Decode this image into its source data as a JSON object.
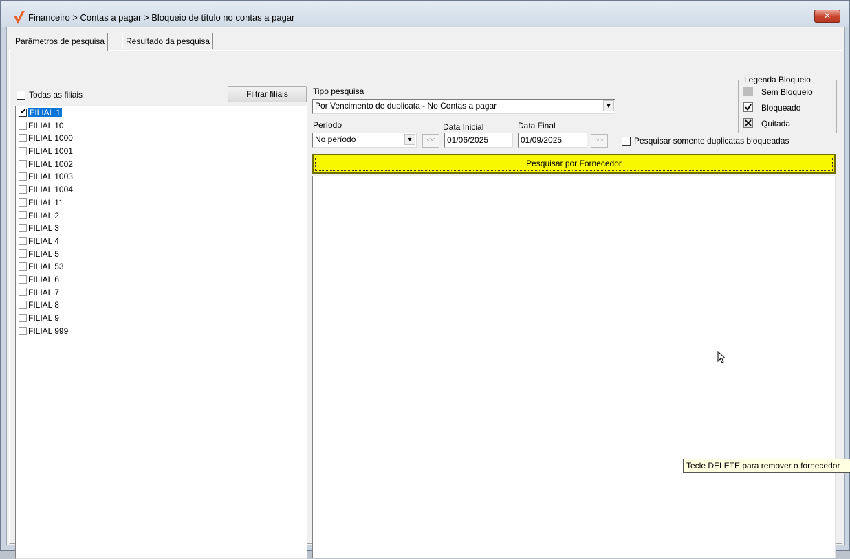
{
  "window": {
    "title": "Financeiro > Contas a pagar > Bloqueio de título no contas a pagar",
    "close_label": "✕"
  },
  "tabs": [
    {
      "label": "Parâmetros de pesquisa",
      "active": true
    },
    {
      "label": "Resultado da pesquisa",
      "active": false
    }
  ],
  "filiais": {
    "all_label": "Todas as filiais",
    "all_checked": false,
    "filter_button": "Filtrar filiais",
    "items": [
      {
        "label": "FILIAL 1",
        "checked": true,
        "selected": true
      },
      {
        "label": "FILIAL 10",
        "checked": false
      },
      {
        "label": "FILIAL 1000",
        "checked": false
      },
      {
        "label": "FILIAL 1001",
        "checked": false
      },
      {
        "label": "FILIAL 1002",
        "checked": false
      },
      {
        "label": "FILIAL 1003",
        "checked": false
      },
      {
        "label": "FILIAL 1004",
        "checked": false
      },
      {
        "label": "FILIAL 11",
        "checked": false
      },
      {
        "label": "FILIAL 2",
        "checked": false
      },
      {
        "label": "FILIAL 3",
        "checked": false
      },
      {
        "label": "FILIAL 4",
        "checked": false
      },
      {
        "label": "FILIAL 5",
        "checked": false
      },
      {
        "label": "FILIAL 53",
        "checked": false
      },
      {
        "label": "FILIAL 6",
        "checked": false
      },
      {
        "label": "FILIAL 7",
        "checked": false
      },
      {
        "label": "FILIAL 8",
        "checked": false
      },
      {
        "label": "FILIAL 9",
        "checked": false
      },
      {
        "label": "FILIAL 999",
        "checked": false
      }
    ]
  },
  "search": {
    "tipo_label": "Tipo pesquisa",
    "tipo_value": "Por Vencimento de duplicata - No Contas a pagar",
    "periodo_label": "Período",
    "periodo_value": "No período",
    "prev_label": "<<",
    "next_label": ">>",
    "data_inicial_label": "Data Inicial",
    "data_inicial_value": "01/06/2025",
    "data_final_label": "Data Final",
    "data_final_value": "01/09/2025",
    "somente_label": "Pesquisar somente duplicatas bloqueadas",
    "somente_checked": false,
    "search_button": "Pesquisar por Fornecedor"
  },
  "legend": {
    "title": "Legenda Bloqueio",
    "items": [
      {
        "label": "Sem Bloqueio",
        "icon": "gray-square-icon"
      },
      {
        "label": "Bloqueado",
        "icon": "check-icon"
      },
      {
        "label": "Quitada",
        "icon": "x-icon"
      }
    ]
  },
  "tooltip": "Tecle DELETE para remover o fornecedor",
  "colors": {
    "search_button_bg": "#f8f900",
    "selection": "#0b74d7",
    "close_button": "#c9442d",
    "logo": "#e8622a"
  }
}
